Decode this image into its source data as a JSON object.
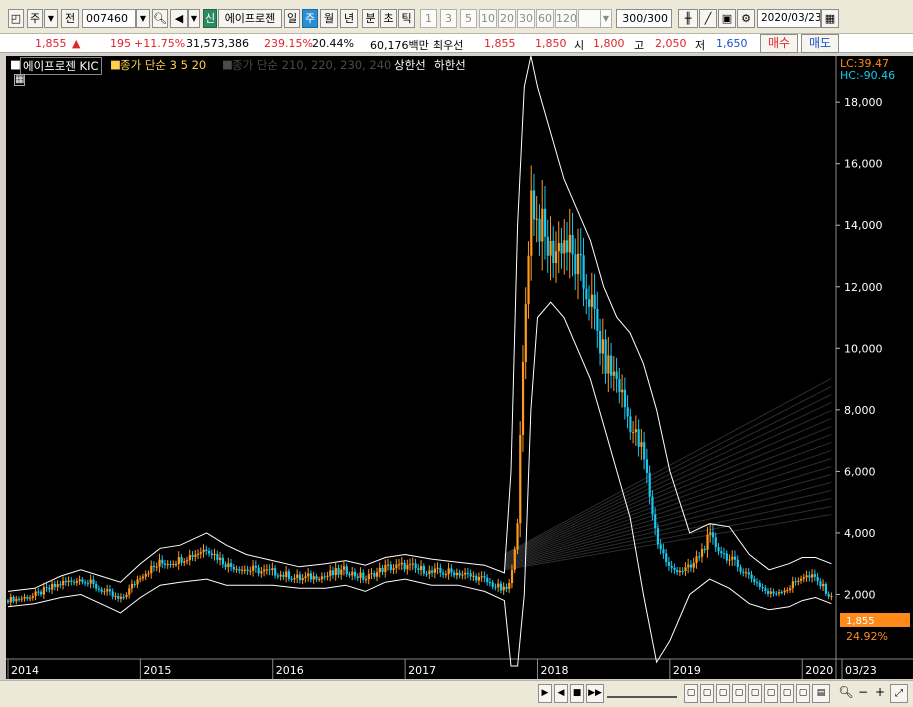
{
  "toolbar": {
    "market_label": "주",
    "scope_label": "전",
    "code": "007460",
    "new_badge": "신",
    "stock_name": "에이프로젠",
    "periods": [
      "일",
      "주",
      "월",
      "년",
      "분",
      "초",
      "틱"
    ],
    "selected_period": "주",
    "intervals": [
      "1",
      "3",
      "5",
      "10",
      "20",
      "30",
      "60",
      "120"
    ],
    "count": "300/300",
    "date": "2020/03/23"
  },
  "quote": {
    "price": "1,855",
    "change_arrow": "▲",
    "change": "195",
    "change_pct": "+11.75%",
    "volume": "31,573,386",
    "volume_ratio": "239.15%",
    "turnover": "20.44%",
    "amount": "60,176백만",
    "best_label": "최우선",
    "best_ask": "1,855",
    "best_bid": "1,850",
    "open_label": "시",
    "open": "1,800",
    "high_label": "고",
    "high": "2,050",
    "low_label": "저",
    "low": "1,650",
    "buy_label": "매수",
    "sell_label": "매도"
  },
  "legend": {
    "name": "에이프로젠 KIC",
    "ma_label": "종가 단순 3  5  20",
    "ma2_label": "종가 단순 210, 220, 230, 240",
    "upper_label": "상한선",
    "lower_label": "하한선",
    "lc": "LC:39.47",
    "hc": "HC:-90.46",
    "current_price": "1,855",
    "current_pct": "24.92%"
  },
  "colors": {
    "up": "#ff9a1f",
    "down": "#18c8ee",
    "band": "#ffffff",
    "grid": "#303030"
  },
  "chart_data": {
    "type": "candlestick",
    "y_ticks": [
      "18,000",
      "16,000",
      "14,000",
      "12,000",
      "10,000",
      "8,000",
      "6,000",
      "4,000",
      "2,000"
    ],
    "y_tick_values": [
      18000,
      16000,
      14000,
      12000,
      10000,
      8000,
      6000,
      4000,
      2000
    ],
    "x_labels": [
      "2014",
      "2015",
      "2016",
      "2017",
      "2018",
      "2019",
      "2020",
      "03/23"
    ],
    "ylim": [
      0,
      19500
    ],
    "x": [
      2014.0,
      2014.2,
      2014.4,
      2014.55,
      2014.7,
      2014.85,
      2015.0,
      2015.15,
      2015.3,
      2015.5,
      2015.65,
      2015.8,
      2016.0,
      2016.2,
      2016.4,
      2016.55,
      2016.7,
      2016.85,
      2017.0,
      2017.2,
      2017.4,
      2017.6,
      2017.75,
      2017.8,
      2017.85,
      2017.9,
      2017.95,
      2018.0,
      2018.1,
      2018.2,
      2018.3,
      2018.4,
      2018.5,
      2018.6,
      2018.7,
      2018.8,
      2018.9,
      2019.0,
      2019.15,
      2019.3,
      2019.45,
      2019.6,
      2019.75,
      2019.9,
      2020.0,
      2020.1,
      2020.22
    ],
    "close": [
      1800,
      1950,
      2350,
      2500,
      2150,
      1800,
      2600,
      3000,
      3100,
      3500,
      2950,
      2800,
      2700,
      2500,
      2600,
      2750,
      2500,
      2850,
      2900,
      2700,
      2700,
      2450,
      2100,
      2400,
      4500,
      10500,
      15000,
      14000,
      13000,
      13500,
      12500,
      11500,
      9500,
      9000,
      7500,
      6500,
      3800,
      2800,
      2800,
      3800,
      3100,
      2600,
      2000,
      2200,
      2600,
      2500,
      1855
    ],
    "upper_band": [
      2100,
      2200,
      2600,
      2800,
      2600,
      2400,
      3000,
      3500,
      3600,
      4000,
      3600,
      3300,
      3100,
      2900,
      3000,
      3100,
      2950,
      3200,
      3300,
      3150,
      3050,
      2950,
      2700,
      6000,
      14000,
      18500,
      19500,
      18500,
      17000,
      15500,
      14500,
      13500,
      12000,
      11000,
      10500,
      9500,
      8000,
      6000,
      4000,
      4300,
      4200,
      3300,
      2800,
      3000,
      3200,
      3200,
      3000
    ],
    "lower_band": [
      1600,
      1700,
      1900,
      2000,
      1700,
      1400,
      1900,
      2300,
      2400,
      2500,
      2300,
      2300,
      2300,
      2200,
      2200,
      2300,
      2100,
      2400,
      2500,
      2300,
      2300,
      2100,
      1800,
      -1500,
      -2000,
      2000,
      8000,
      11000,
      11500,
      11000,
      10000,
      9000,
      7500,
      6000,
      4500,
      2000,
      -200,
      500,
      2000,
      2500,
      2200,
      1700,
      1500,
      1600,
      1800,
      1900,
      1700
    ]
  },
  "bottom": {
    "controls": [
      "▶",
      "◀",
      "■",
      "▶▶"
    ],
    "zoom_minus": "−",
    "zoom_plus": "+"
  }
}
